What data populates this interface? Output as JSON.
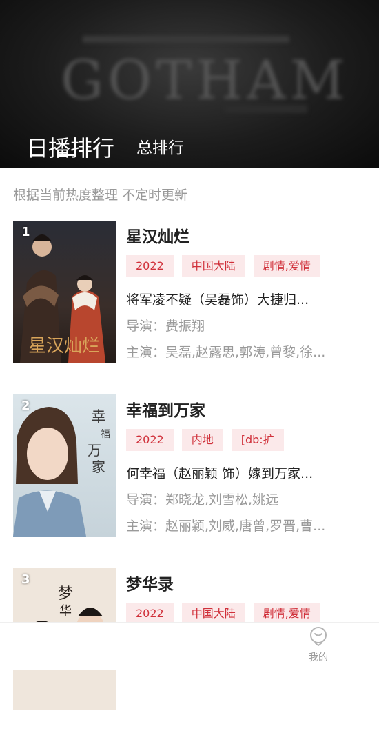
{
  "hero": {
    "watermark": "GOTHAM"
  },
  "tabs": [
    {
      "label": "日播排行",
      "active": true
    },
    {
      "label": "总排行",
      "active": false
    }
  ],
  "subtitle": "根据当前热度整理 不定时更新",
  "items": [
    {
      "rank": "1",
      "title": "星汉灿烂",
      "poster_text": "星汉灿烂",
      "tags": [
        "2022",
        "中国大陆",
        "剧情,爱情"
      ],
      "desc": "将军凌不疑（吴磊饰）大捷归...",
      "director": "导演：费振翔",
      "cast": "主演：吴磊,赵露思,郭涛,曾黎,徐..."
    },
    {
      "rank": "2",
      "title": "幸福到万家",
      "poster_text": "幸福到万家",
      "tags": [
        "2022",
        "内地",
        "[db:扩"
      ],
      "desc": "何幸福（赵丽颖 饰）嫁到万家...",
      "director": "导演：郑晓龙,刘雪松,姚远",
      "cast": "主演：赵丽颖,刘威,唐曾,罗晋,曹..."
    },
    {
      "rank": "3",
      "title": "梦华录",
      "poster_text": "梦华",
      "tags": [
        "2022",
        "中国大陆",
        "剧情,爱情"
      ],
      "desc": "",
      "director": "",
      "cast": ""
    }
  ],
  "bottom_nav": {
    "label": "我的",
    "icon": "profile-icon"
  },
  "colors": {
    "tag_bg": "#fbe9ea",
    "tag_text": "#d0303a",
    "hero_bg": "#1c1c1c"
  }
}
